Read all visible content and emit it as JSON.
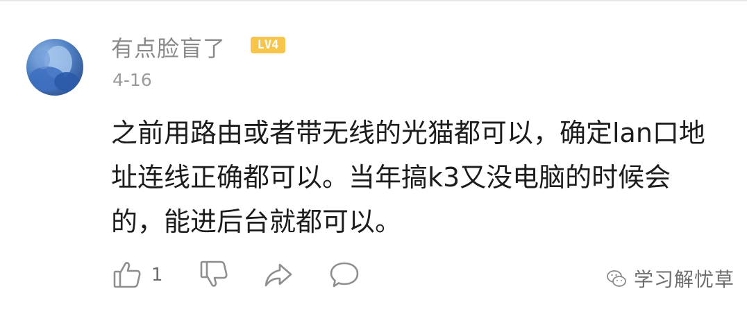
{
  "comment": {
    "username": "有点脸盲了",
    "level_badge": "LV4",
    "date": "4-16",
    "text": "之前用路由或者带无线的光猫都可以，确定lan口地址连线正确都可以。当年搞k3又没电脑的时候会的，能进后台就都可以。",
    "like_count": "1"
  },
  "actions": {
    "like_icon": "thumbs-up-icon",
    "dislike_icon": "thumbs-down-icon",
    "share_icon": "share-arrow-icon",
    "reply_icon": "chat-bubble-icon"
  },
  "watermark": {
    "icon": "wechat-icon",
    "text": "学习解忧草"
  },
  "colors": {
    "level_badge_bg": "#f6c54a",
    "username": "#8a8a8a",
    "body_text": "#1c1c1c",
    "icon_gray": "#8e8e8e"
  }
}
